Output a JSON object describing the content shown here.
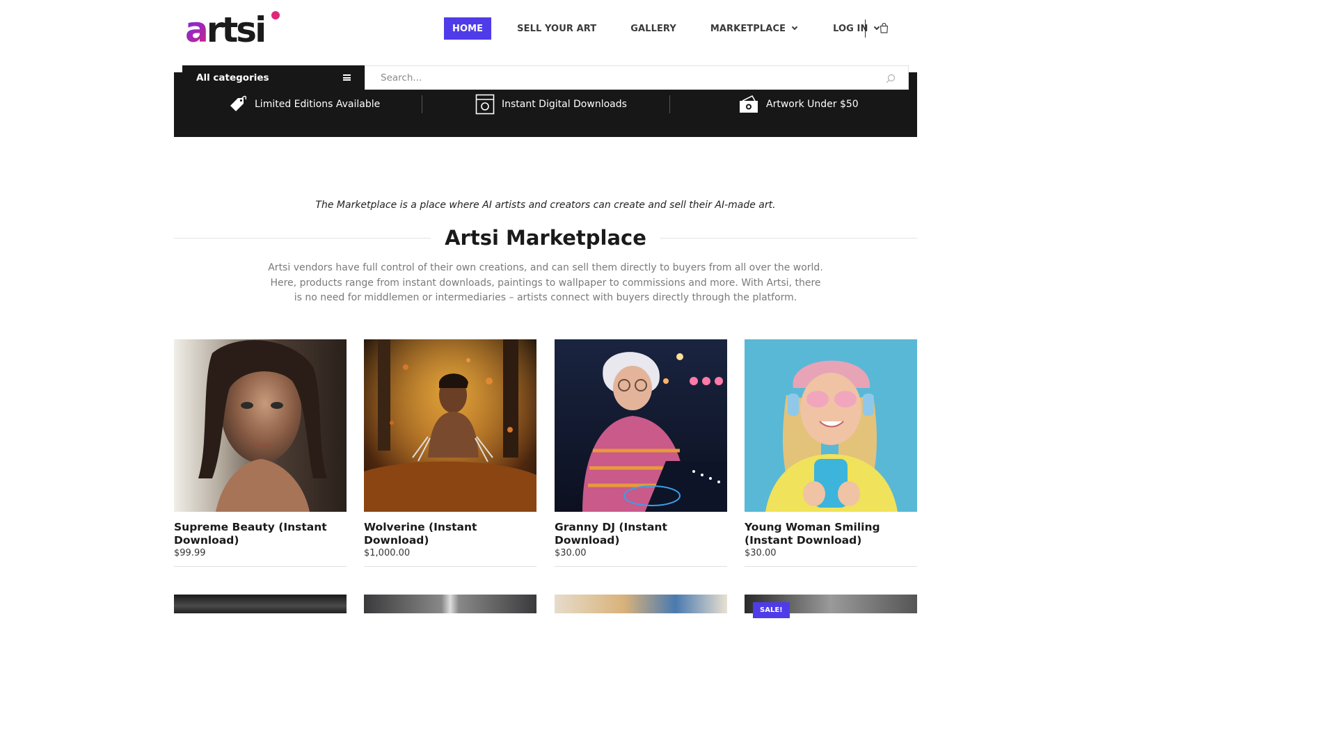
{
  "brand": {
    "logo_a": "a",
    "logo_rest": "rts",
    "logo_i": "i"
  },
  "nav": {
    "items": [
      {
        "label": "HOME",
        "active": true
      },
      {
        "label": "SELL YOUR ART"
      },
      {
        "label": "GALLERY"
      },
      {
        "label": "MARKETPLACE",
        "dropdown": true
      },
      {
        "label": "LOG IN",
        "dropdown": true
      }
    ]
  },
  "search": {
    "category_label": "All categories",
    "placeholder": "Search..."
  },
  "features": [
    {
      "icon": "price-tag-icon",
      "label": "Limited Editions Available"
    },
    {
      "icon": "download-box-icon",
      "label": "Instant Digital Downloads"
    },
    {
      "icon": "cash-icon",
      "label": "Artwork Under $50"
    }
  ],
  "intro": {
    "tagline": "The Marketplace is a place where AI artists and creators can create and sell their AI-made art.",
    "title": "Artsi Marketplace",
    "description": "Artsi vendors have full control of their own creations, and can sell them directly to buyers from all over the world. Here, products range from instant downloads, paintings to wallpaper to commissions and more. With Artsi, there is no need for middlemen or intermediaries – artists connect with buyers directly through the platform."
  },
  "products": [
    {
      "name": "Supreme Beauty (Instant Download)",
      "price": "$99.99"
    },
    {
      "name": "Wolverine (Instant Download)",
      "price": "$1,000.00"
    },
    {
      "name": "Granny DJ (Instant Download)",
      "price": "$30.00"
    },
    {
      "name": "Young Woman Smiling (Instant Download)",
      "price": "$30.00"
    }
  ],
  "badges": {
    "sale": "SALE!"
  },
  "colors": {
    "accent": "#4f3ce8",
    "dark_bar": "#171717",
    "logo_gradient_start": "#6a2cf0",
    "logo_gradient_end": "#d4237e"
  }
}
